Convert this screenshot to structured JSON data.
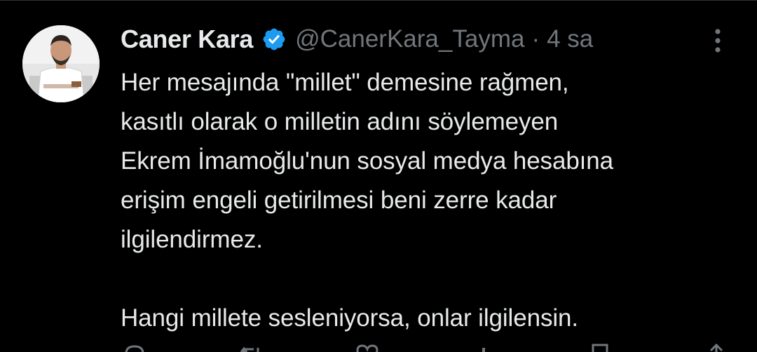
{
  "tweet": {
    "author_name": "Caner Kara",
    "handle": "@CanerKara_Tayma",
    "separator": "·",
    "time": "4 sa",
    "verified": true,
    "text": "Her mesajında \"millet\" demesine rağmen,\nkasıtlı olarak o milletin adını söylemeyen\nEkrem İmamoğlu'nun sosyal medya hesabına\nerişim engeli getirilmesi beni zerre kadar\nilgilendirmez.\n\nHangi millete sesleniyorsa, onlar ilgilensin."
  },
  "icons": {
    "verified": "verified-badge-icon",
    "more": "more-vertical-icon",
    "actions": [
      "reply-icon",
      "retweet-icon",
      "like-icon",
      "views-icon",
      "bookmark-icon",
      "share-icon"
    ]
  },
  "colors": {
    "background": "#000000",
    "text_primary": "#e7e9ea",
    "text_secondary": "#71767b",
    "verified_blue": "#1d9bf0",
    "divider": "#2f3336"
  }
}
